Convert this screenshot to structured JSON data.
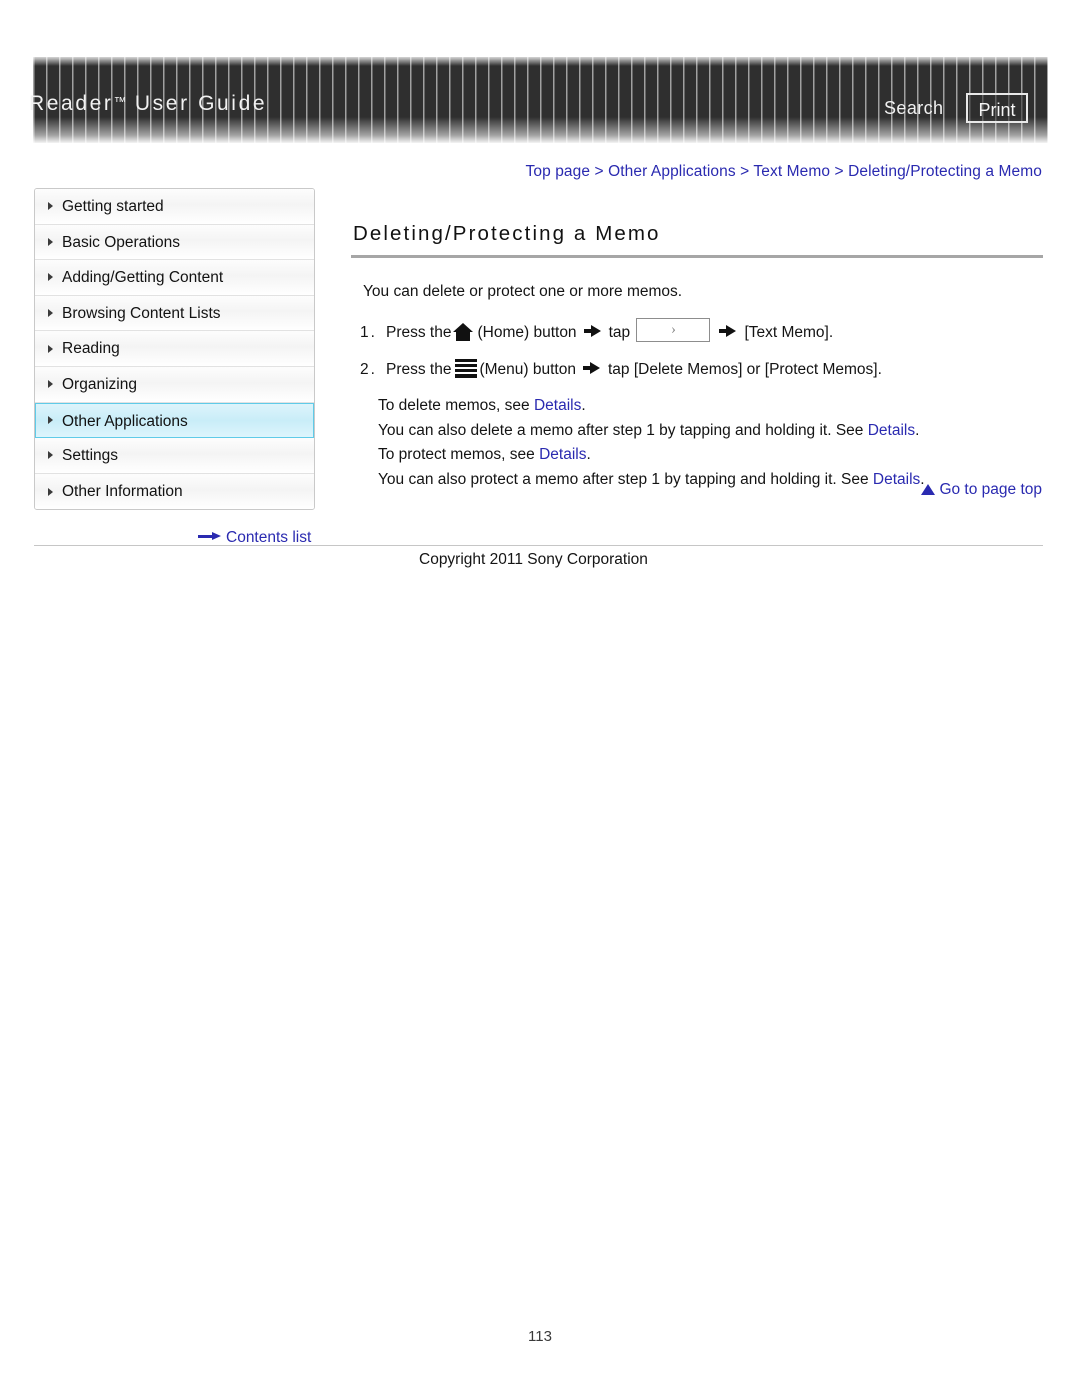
{
  "header": {
    "title_main": "Reader",
    "title_tm": "™",
    "title_rest": " User Guide",
    "search_label": "Search",
    "print_label": "Print"
  },
  "breadcrumb": {
    "items": [
      "Top page",
      "Other Applications",
      "Text Memo",
      "Deleting/Protecting a Memo"
    ],
    "separator": ">",
    "full": "Top page > Other Applications > Text Memo > Deleting/Protecting a Memo"
  },
  "sidebar": {
    "items": [
      {
        "label": "Getting started",
        "active": false
      },
      {
        "label": "Basic Operations",
        "active": false
      },
      {
        "label": "Adding/Getting Content",
        "active": false
      },
      {
        "label": "Browsing Content Lists",
        "active": false
      },
      {
        "label": "Reading",
        "active": false
      },
      {
        "label": "Organizing",
        "active": false
      },
      {
        "label": "Other Applications",
        "active": true
      },
      {
        "label": "Settings",
        "active": false
      },
      {
        "label": "Other Information",
        "active": false
      }
    ],
    "contents_list_label": "Contents list"
  },
  "main": {
    "heading": "Deleting/Protecting a Memo",
    "intro": "You can delete or protect one or more memos.",
    "steps": [
      {
        "number": "1.",
        "pre": "Press the",
        "icon": "home-icon",
        "mid": "(Home) button",
        "tap_label": "tap",
        "button_glyph": "›",
        "post": "[Text Memo]."
      },
      {
        "number": "2.",
        "pre": "Press the",
        "icon": "menu-icon",
        "mid": "(Menu) button",
        "tap_label": "tap [Delete Memos] or [Protect Memos]."
      }
    ],
    "notes": [
      {
        "before": "To delete memos, see ",
        "link": "Details",
        "after": "."
      },
      {
        "before": "You can also delete a memo after step 1 by tapping and holding it. See ",
        "link": "Details",
        "after": "."
      },
      {
        "before": "To protect memos, see ",
        "link": "Details",
        "after": "."
      },
      {
        "before": "You can also protect a memo after step 1 by tapping and holding it. See ",
        "link": "Details",
        "after": "."
      }
    ],
    "go_to_top_label": "Go to page top"
  },
  "footer": {
    "copyright": "Copyright 2011 Sony Corporation",
    "page_number": "113"
  },
  "colors": {
    "link": "#2a2ab0",
    "header_bg": "#2f2f2f",
    "active_nav": "#c9edf8",
    "active_nav_border": "#5fcbe8",
    "rule": "#a6a6a6"
  }
}
